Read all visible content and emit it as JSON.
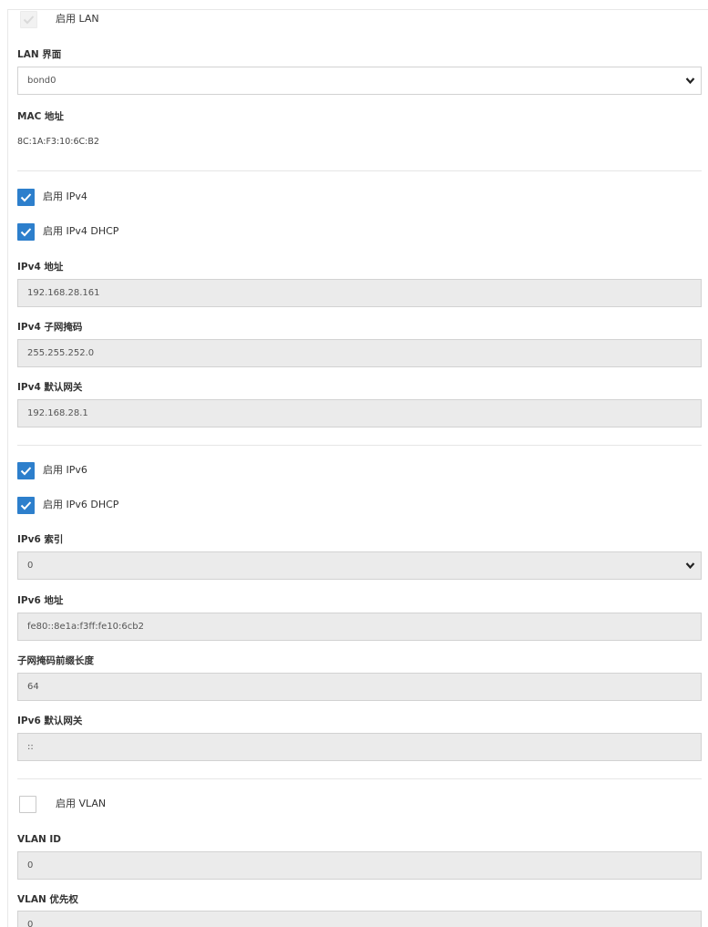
{
  "lan": {
    "enable_lan_label": "启用 LAN",
    "enable_lan_checked": true,
    "enable_lan_disabled": true,
    "interface_label": "LAN 界面",
    "interface_value": "bond0",
    "mac_label": "MAC 地址",
    "mac_value": "8C:1A:F3:10:6C:B2"
  },
  "ipv4": {
    "enable_label": "启用 IPv4",
    "enable_checked": true,
    "dhcp_label": "启用 IPv4 DHCP",
    "dhcp_checked": true,
    "address_label": "IPv4 地址",
    "address_value": "192.168.28.161",
    "mask_label": "IPv4 子网掩码",
    "mask_value": "255.255.252.0",
    "gateway_label": "IPv4 默认网关",
    "gateway_value": "192.168.28.1"
  },
  "ipv6": {
    "enable_label": "启用 IPv6",
    "enable_checked": true,
    "dhcp_label": "启用 IPv6 DHCP",
    "dhcp_checked": true,
    "index_label": "IPv6 索引",
    "index_value": "0",
    "address_label": "IPv6 地址",
    "address_value": "fe80::8e1a:f3ff:fe10:6cb2",
    "prefix_label": "子网掩码前缀长度",
    "prefix_value": "64",
    "gateway_label": "IPv6 默认网关",
    "gateway_value": "::"
  },
  "vlan": {
    "enable_label": "启用 VLAN",
    "enable_checked": false,
    "id_label": "VLAN ID",
    "id_value": "0",
    "priority_label": "VLAN 优先权",
    "priority_value": "0"
  },
  "colors": {
    "checkbox_checked": "#2d7fcc",
    "input_disabled_bg": "#ebebeb",
    "border": "#d2d2d2"
  },
  "icons": {
    "check": "check-icon",
    "dropdown": "chevron-down-icon"
  }
}
